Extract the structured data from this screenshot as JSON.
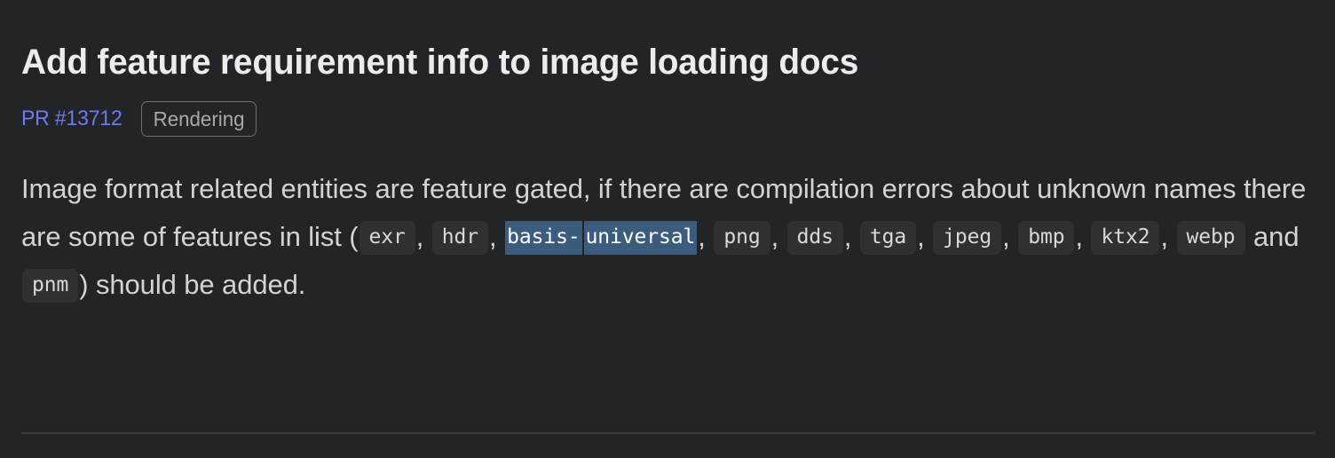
{
  "theme": {
    "background": "#232427",
    "title_color": "#ececec",
    "body_color": "#d2d3d5",
    "link_color": "#6b7bf0",
    "badge_border": "#6e7074",
    "badge_text": "#a7a9ad",
    "code_bg": "#2e3034",
    "code_text": "#d8d9db",
    "selection_bg": "#3c5c7e",
    "selection_text": "#ffffff",
    "divider_color": "#3a3b3e"
  },
  "pull_request": {
    "title": "Add feature requirement info to image loading docs",
    "number_label": "PR #13712",
    "label_badge": "Rendering"
  },
  "body": {
    "segment_1": "Image format related entities are feature gated, if there are compilation errors about unknown names there are some of features in list",
    "paren_open": "(",
    "code_exr": "exr",
    "comma_1": ",",
    "code_hdr": "hdr",
    "comma_2": ",",
    "code_basis_universal_part1": "basis-",
    "code_basis_universal_part2": "universal",
    "comma_3": ",",
    "code_png": "png",
    "comma_4": ",",
    "code_dds": "dds",
    "comma_5": ",",
    "code_tga": "tga",
    "comma_6": ",",
    "code_jpeg": "jpeg",
    "comma_7": ",",
    "code_bmp": "bmp",
    "comma_8": ",",
    "code_ktx2": "ktx2",
    "comma_9": ",",
    "code_webp": "webp",
    "conjunction": "and",
    "code_pnm": "pnm",
    "paren_close": ")",
    "segment_2": "should be added."
  }
}
